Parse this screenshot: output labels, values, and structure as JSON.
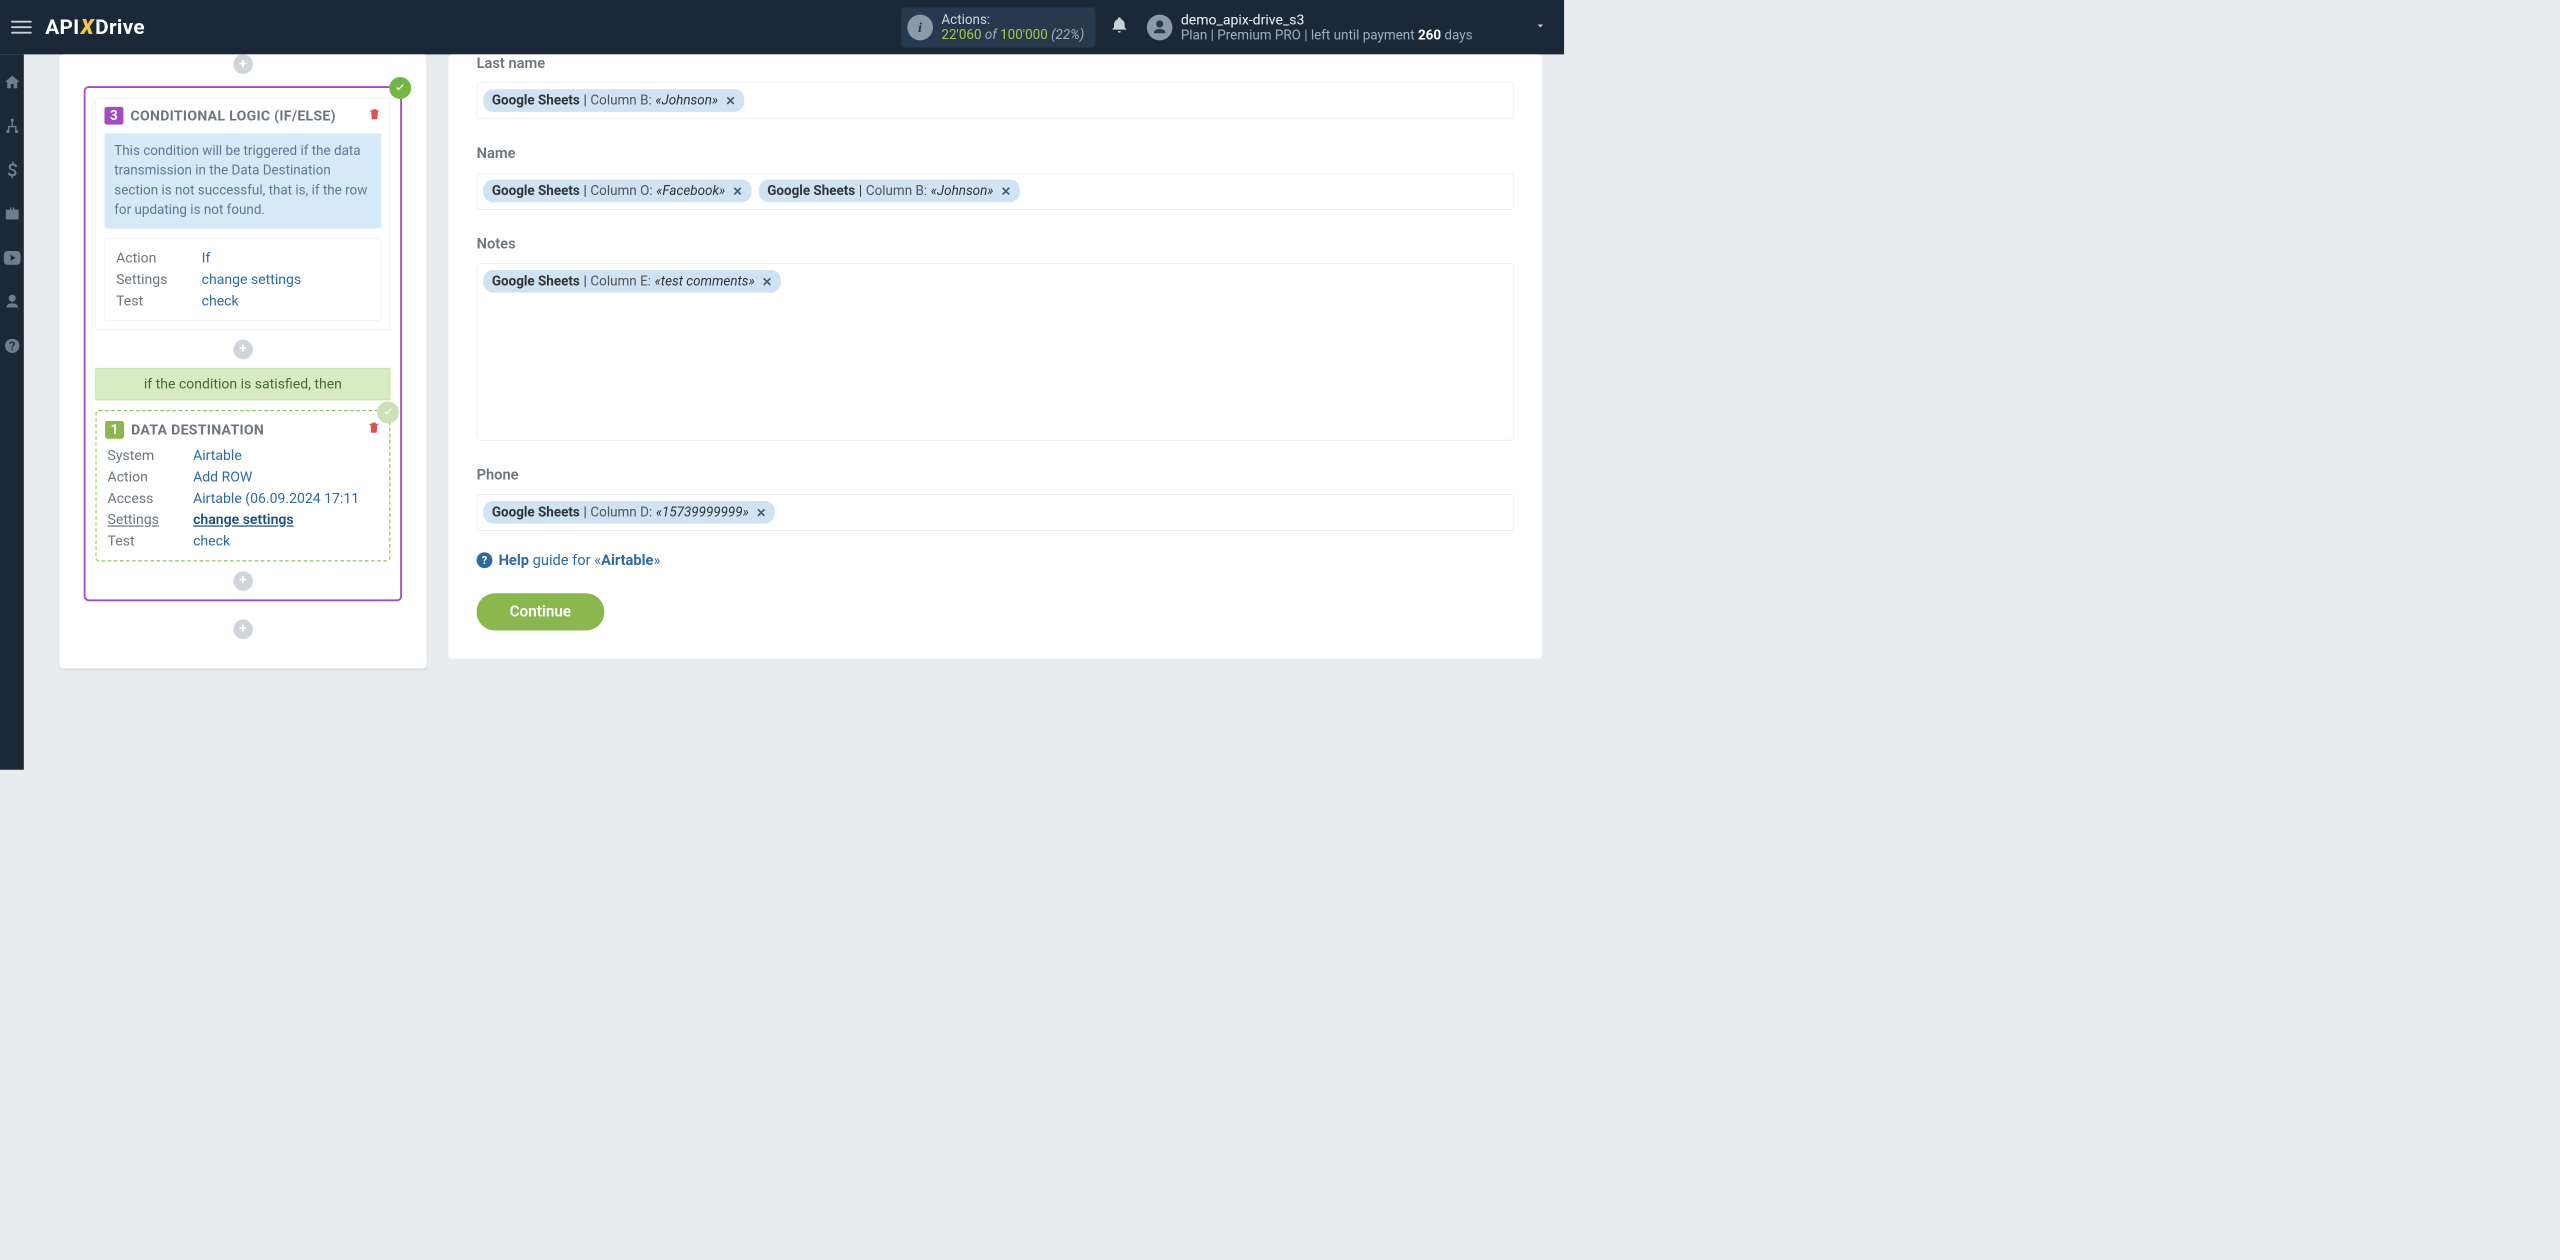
{
  "header": {
    "logo_pre": "API",
    "logo_x": "X",
    "logo_post": "Drive",
    "actions_label": "Actions:",
    "actions_current": "22'060",
    "actions_of": " of ",
    "actions_max": "100'000",
    "actions_pct": " (22%)",
    "username": "demo_apix-drive_s3",
    "plan_prefix": "Plan  | Premium PRO |  left until payment ",
    "plan_days": "260",
    "plan_suffix": " days"
  },
  "sidebar_icons": [
    "home",
    "sitemap",
    "dollar",
    "briefcase",
    "youtube",
    "user",
    "help"
  ],
  "flow": {
    "cond": {
      "num": "3",
      "title": "CONDITIONAL LOGIC (IF/ELSE)",
      "banner": "This condition will be triggered if the data transmission in the Data Destination section is not successful, that is, if the row for updating is not found.",
      "rows": [
        {
          "k": "Action",
          "v": "If"
        },
        {
          "k": "Settings",
          "v": "change settings"
        },
        {
          "k": "Test",
          "v": "check"
        }
      ]
    },
    "cond_bar": "if the condition is satisfied, then",
    "dest": {
      "num": "1",
      "title": "DATA DESTINATION",
      "rows": [
        {
          "k": "System",
          "v": "Airtable"
        },
        {
          "k": "Action",
          "v": "Add ROW"
        },
        {
          "k": "Access",
          "v": "Airtable (06.09.2024 17:11"
        },
        {
          "k": "Settings",
          "v": "change settings",
          "link": true,
          "kunder": true
        },
        {
          "k": "Test",
          "v": "check"
        }
      ]
    }
  },
  "fields": {
    "last_name": {
      "label": "Last name",
      "chips": [
        {
          "src": "Google Sheets",
          "col": "Column B:",
          "val": "«Johnson»"
        }
      ]
    },
    "name": {
      "label": "Name",
      "chips": [
        {
          "src": "Google Sheets",
          "col": "Column O:",
          "val": "«Facebook»"
        },
        {
          "src": "Google Sheets",
          "col": "Column B:",
          "val": "«Johnson»"
        }
      ]
    },
    "notes": {
      "label": "Notes",
      "chips": [
        {
          "src": "Google Sheets",
          "col": "Column E:",
          "val": "«test comments»"
        }
      ]
    },
    "phone": {
      "label": "Phone",
      "chips": [
        {
          "src": "Google Sheets",
          "col": "Column D:",
          "val": "«15739999999»"
        }
      ]
    }
  },
  "help": {
    "pre": "Help",
    "mid": " guide for «",
    "svc": "Airtable",
    "post": "»"
  },
  "buttons": {
    "continue": "Continue"
  }
}
